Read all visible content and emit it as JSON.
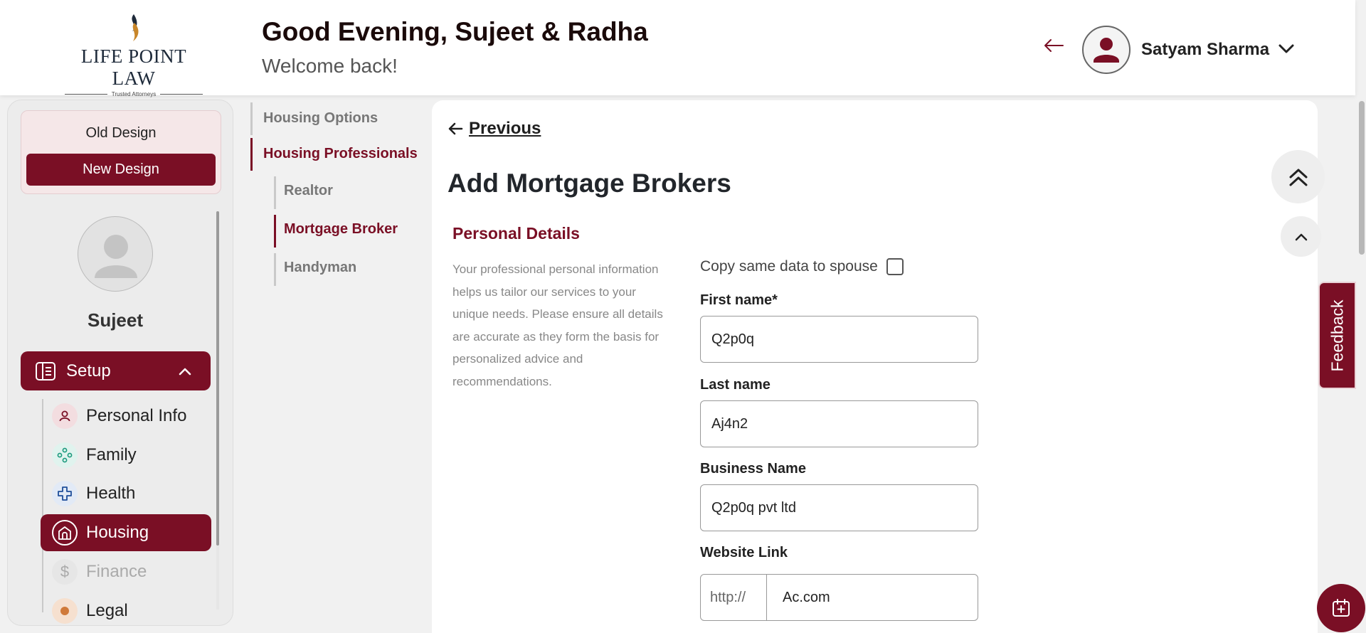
{
  "header": {
    "logo_text": "LIFE POINT LAW",
    "logo_tagline": "Trusted Attorneys",
    "greeting": "Good Evening, Sujeet & Radha",
    "welcome": "Welcome back!",
    "user_name": "Satyam Sharma"
  },
  "sidebar": {
    "old_design": "Old Design",
    "new_design": "New Design",
    "profile_name": "Sujeet",
    "setup_label": "Setup",
    "items": [
      {
        "label": "Personal Info",
        "icon": "person-icon"
      },
      {
        "label": "Family",
        "icon": "family-icon"
      },
      {
        "label": "Health",
        "icon": "health-cross-icon"
      },
      {
        "label": "Housing",
        "icon": "home-icon",
        "active": true
      },
      {
        "label": "Finance",
        "icon": "dollar-icon"
      },
      {
        "label": "Legal",
        "icon": "legal-icon"
      }
    ]
  },
  "subnav": {
    "housing_options": "Housing Options",
    "housing_professionals": "Housing Professionals",
    "realtor": "Realtor",
    "mortgage_broker": "Mortgage Broker",
    "handyman": "Handyman"
  },
  "main": {
    "previous": "Previous",
    "title": "Add Mortgage Brokers",
    "section_title": "Personal Details",
    "section_desc": "Your professional personal information helps us tailor our services to your unique needs. Please ensure all details are accurate as they form the basis for personalized advice and recommendations.",
    "copy_to_spouse": "Copy same data to spouse",
    "first_name_label": "First name*",
    "first_name_value": "Q2p0q",
    "last_name_label": "Last name",
    "last_name_value": "Aj4n2",
    "business_name_label": "Business Name",
    "business_name_value": "Q2p0q pvt ltd",
    "website_label": "Website Link",
    "website_prefix": "http://",
    "website_value": "Ac.com"
  },
  "feedback_label": "Feedback",
  "colors": {
    "brand": "#7a0f25",
    "background": "#f1f1f1"
  }
}
